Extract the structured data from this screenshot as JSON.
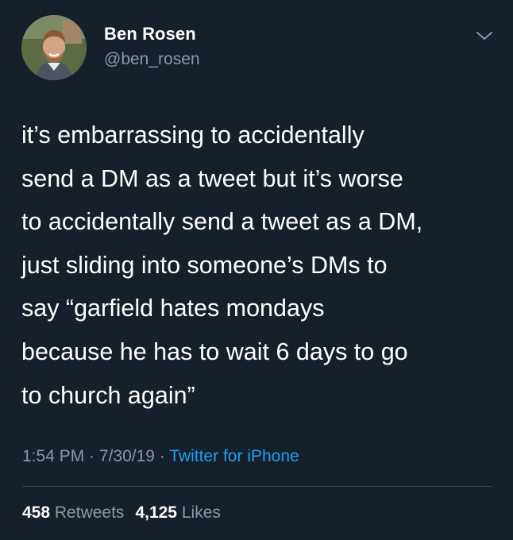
{
  "author": {
    "name": "Ben Rosen",
    "handle": "@ben_rosen"
  },
  "icons": {
    "menu": "chevron-down-icon"
  },
  "tweet": {
    "text": "it’s embarrassing to accidentally\nsend a DM as a tweet but it’s worse\nto accidentally send a tweet as a DM,\njust sliding into someone’s DMs to\nsay “garfield hates mondays\nbecause he has to wait 6 days to go\nto church again”"
  },
  "meta": {
    "time": "1:54 PM",
    "separator1": " · ",
    "date": "7/30/19",
    "separator2": " · ",
    "source": "Twitter for iPhone"
  },
  "stats": {
    "retweets_count": "458",
    "retweets_label": "Retweets",
    "likes_count": "4,125",
    "likes_label": "Likes"
  },
  "colors": {
    "background": "#15202b",
    "secondary_text": "#8899a6",
    "link": "#1da1f2",
    "divider": "#38444d"
  }
}
